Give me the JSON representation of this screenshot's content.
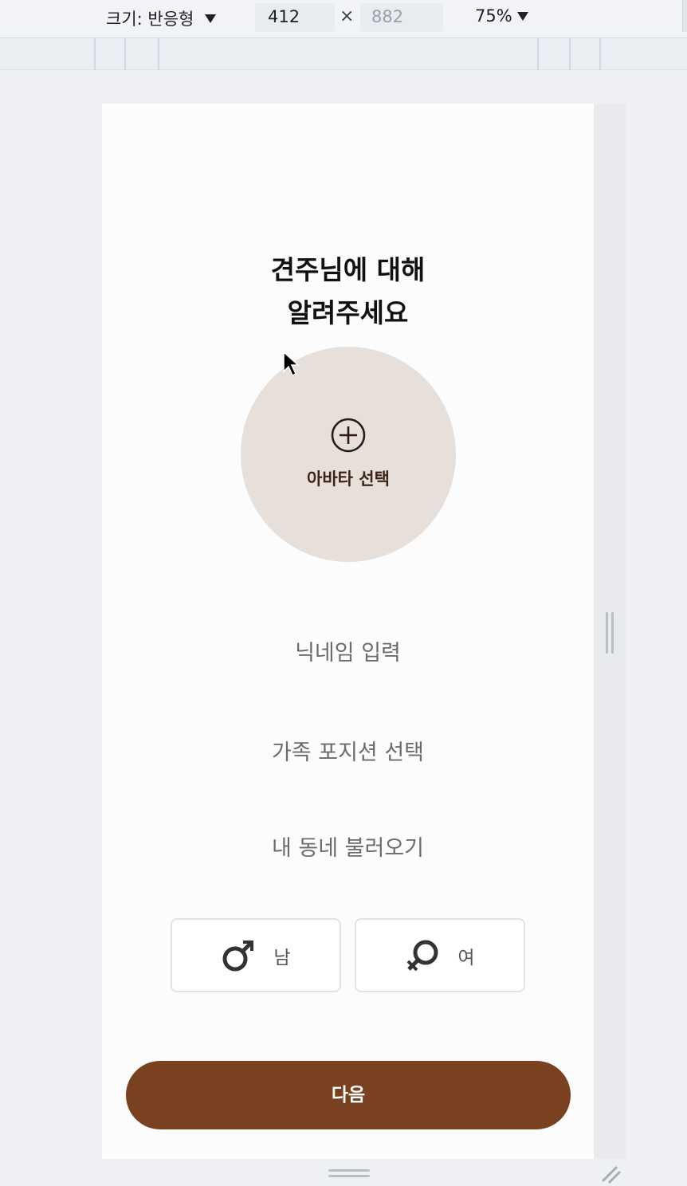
{
  "devtools": {
    "size_label": "크기: 반응형",
    "width_value": "412",
    "times_symbol": "×",
    "height_value": "882",
    "zoom_label": "75%"
  },
  "page": {
    "title_line1": "견주님에 대해",
    "title_line2": "알려주세요",
    "avatar_label": "아바타 선택",
    "nickname_placeholder": "닉네임 입력",
    "family_position": "가족 포지션 선택",
    "neighborhood": "내 동네 불러오기",
    "gender_male": "남",
    "gender_female": "여",
    "next_button": "다음"
  },
  "colors": {
    "brand_brown": "#7a4120",
    "avatar_bg": "#e7dfd9",
    "text_dark": "#111111"
  },
  "icons": {
    "avatar_add": "plus-circle-icon",
    "male": "male-symbol-icon",
    "female": "female-symbol-icon"
  }
}
